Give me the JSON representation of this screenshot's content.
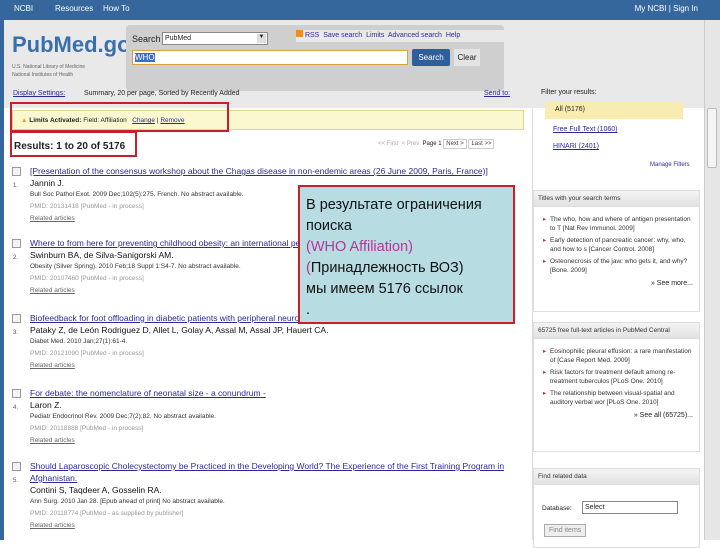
{
  "topbar": {
    "ncbi": "NCBI",
    "resources": "Resources",
    "howto": "How To",
    "account": "My NCBI | Sign In"
  },
  "header": {
    "logo": "PubMed.gov",
    "logo_sub1": "U.S. National Library of Medicine",
    "logo_sub2": "National Institutes of Health",
    "search_label": "Search",
    "db_value": "PubMed",
    "query": "WHO",
    "search_btn": "Search",
    "clear_btn": "Clear",
    "links": [
      "RSS",
      "Save search",
      "Limits",
      "Advanced search",
      "Help"
    ]
  },
  "toolbar": {
    "display_settings": "Display Settings:",
    "summary": "Summary, 20 per page, Sorted by Recently Added",
    "send_to": "Send to:"
  },
  "limits": {
    "label": "Limits Activated:",
    "field": "Field: Affiliation",
    "change": "Change",
    "remove": "Remove"
  },
  "results_count": "Results: 1 to 20 of 5176",
  "pager": {
    "first": "<< First",
    "prev": "< Prev",
    "page": "Page 1",
    "next": "Next >",
    "last": "Last >>"
  },
  "results": [
    {
      "num": "1.",
      "title": "[Presentation of the consensus workshop about the Chagas disease in non-endemic areas (26 June 2009, Paris, France)]",
      "authors": "Jannin J.",
      "source": "Bull Soc Pathol Exot. 2009 Dec;102(5):275. French. No abstract available.",
      "pmid": "PMID: 20131418 [PubMed - in process]",
      "related": "Related articles"
    },
    {
      "num": "2.",
      "title": "Where to from here for preventing childhood obesity: an international perspective.",
      "authors": "Swinburn BA, de Silva-Sanigorski AM.",
      "source": "Obesity (Silver Spring). 2010 Feb;18 Suppl 1:S4-7. No abstract available.",
      "pmid": "PMID: 20107460 [PubMed - in process]",
      "related": "Related articles"
    },
    {
      "num": "3.",
      "title": "Biofeedback for foot offloading in diabetic patients with peripheral neuropathy.",
      "authors": "Pataky Z, de León Rodriguez D, Allet L, Golay A, Assal M, Assal JP, Hauert CA.",
      "source": "Diabet Med. 2010 Jan;27(1):61-4.",
      "pmid": "PMID: 20121090 [PubMed - in process]",
      "related": "Related articles"
    },
    {
      "num": "4.",
      "title": "For debate: the nomenclature of neonatal size - a conundrum -",
      "authors": "Laron Z.",
      "source": "Pediatr Endocrinol Rev. 2009 Dec;7(2):82. No abstract available.",
      "pmid": "PMID: 20118888 [PubMed - in process]",
      "related": "Related articles"
    },
    {
      "num": "5.",
      "title": "Should Laparoscopic Cholecystectomy be Practiced in the Developing World? The Experience of the First Training Program in Afghanistan.",
      "authors": "Contini S, Taqdeer A, Gosselin RA.",
      "source": "Ann Surg. 2010 Jan 28. [Epub ahead of print] No abstract available.",
      "pmid": "PMID: 20118774 [PubMed - as supplied by publisher]",
      "related": "Related articles"
    }
  ],
  "filters": {
    "title": "Filter your results:",
    "items": [
      "All (5176)",
      "Free Full Text (1060)",
      "HINARI (2401)"
    ],
    "manage": "Manage Filters"
  },
  "titles_box": {
    "header": "Titles with your search terms",
    "items": [
      "The who, how and where of antigen presentation to T [Nat Rev Immunol. 2009]",
      "Early detection of pancreatic cancer: why, who, and how to s [Cancer Control. 2008]",
      "Osteonecrosis of the jaw: who gets it, and why? [Bone. 2009]"
    ],
    "more": "» See more..."
  },
  "pmc_box": {
    "header": "65725 free full-text articles in PubMed Central",
    "items": [
      "Eosinophilic pleural effusion: a rare manifestation of [Case Report Med. 2009]",
      "Risk factors for treatment default among re-treatment tuberculos [PLoS One. 2010]",
      "The relationship between visual-spatial and auditory verbal wor [PLoS One. 2010]"
    ],
    "more": "» See all (65725)..."
  },
  "related_data": {
    "header": "Find related data",
    "db_label": "Database:",
    "db_value": "Select",
    "find_btn": "Find items"
  },
  "callout": {
    "line1": "В результате ограничения поиска",
    "paren_open": "(",
    "who": "WHO Affiliation)",
    "line3": "Принадлежность ВОЗ)",
    "line4": "мы имеем  5176 ссылок",
    "line5": "."
  },
  "colors": {
    "callout_bg": "#b7dde3",
    "accent": "#c8202a",
    "who": "#c0309a"
  }
}
